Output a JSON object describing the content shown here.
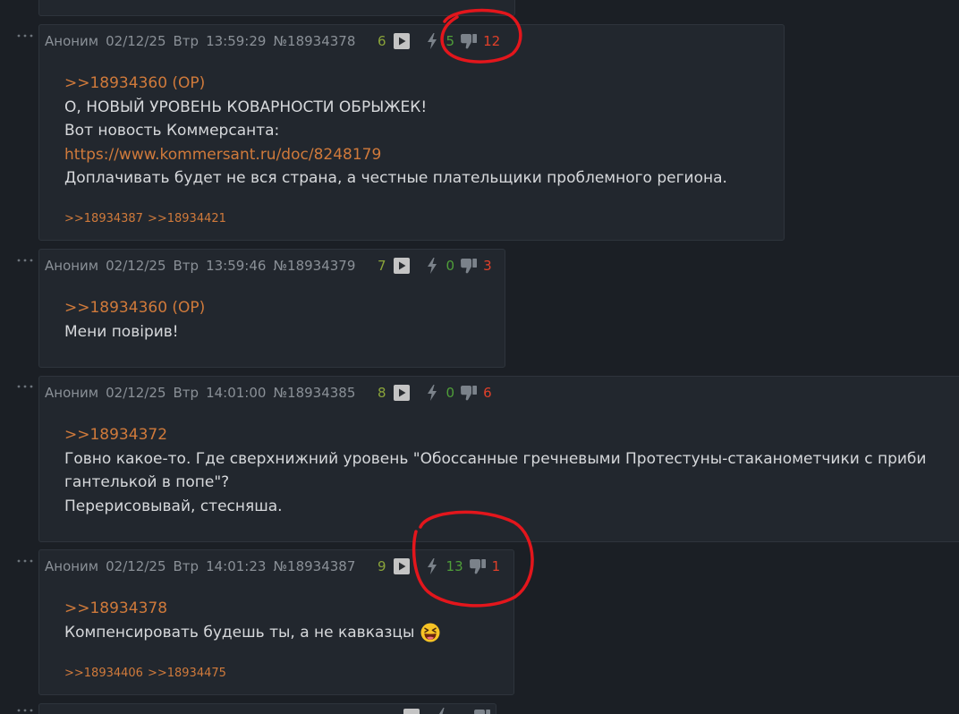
{
  "theme": {
    "page_bg": "#1b1f25",
    "post_bg": "#22272e",
    "post_border": "#2e343c",
    "header_text": "#8a9097",
    "body_text": "#d6d8db",
    "link_color": "#d07a3b",
    "post_index_color": "#8aa43a",
    "likes_color": "#4f9e39",
    "dislikes_color": "#e0402a",
    "annotation_color": "#e3161c"
  },
  "icons": {
    "menu": "more-dots-icon",
    "play": "play-icon",
    "like": "lightning-icon",
    "dislike": "thumbs-down-icon"
  },
  "posts": [
    {
      "author": "Аноним",
      "date": "02/12/25",
      "weekday": "Втр",
      "time": "13:59:29",
      "number": "№18934378",
      "index": "6",
      "likes": "5",
      "dislikes": "12",
      "body": [
        ">>18934360 (OP)",
        "О, НОВЫЙ УРОВЕНЬ КОВАРНОСТИ ОБРЫЖЕК!",
        "Вот новость Коммерсанта:",
        "https://www.kommersant.ru/doc/8248179",
        "Доплачивать будет не вся страна, а честные плательщики проблемного региона."
      ],
      "replies": [
        ">>18934387",
        ">>18934421"
      ]
    },
    {
      "author": "Аноним",
      "date": "02/12/25",
      "weekday": "Втр",
      "time": "13:59:46",
      "number": "№18934379",
      "index": "7",
      "likes": "0",
      "dislikes": "3",
      "body": [
        ">>18934360 (OP)",
        "Мени повірив!"
      ],
      "replies": []
    },
    {
      "author": "Аноним",
      "date": "02/12/25",
      "weekday": "Втр",
      "time": "14:01:00",
      "number": "№18934385",
      "index": "8",
      "likes": "0",
      "dislikes": "6",
      "body": [
        ">>18934372",
        "Говно какое-то. Где сверхнижний уровень \"Обоссанные гречневыми Протестуны-стаканометчики с приби",
        "гантелькой в попе\"?",
        "Перерисовывай, стесняша."
      ],
      "replies": []
    },
    {
      "author": "Аноним",
      "date": "02/12/25",
      "weekday": "Втр",
      "time": "14:01:23",
      "number": "№18934387",
      "index": "9",
      "likes": "13",
      "dislikes": "1",
      "body": [
        ">>18934378",
        "Компенсировать будешь ты, а не кавказцы"
      ],
      "emoji": "grinning-squinting-face",
      "replies": [
        ">>18934406",
        ">>18934475"
      ]
    }
  ]
}
